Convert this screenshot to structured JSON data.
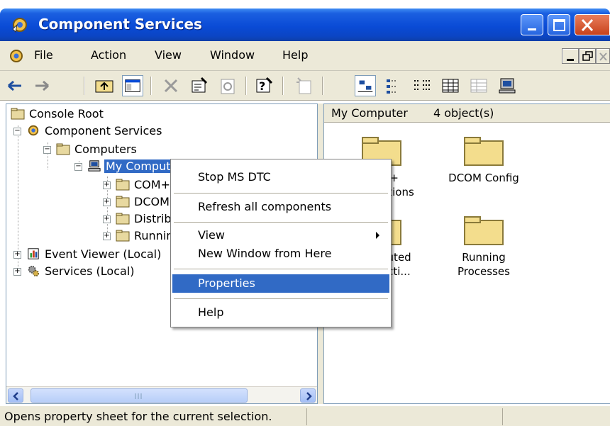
{
  "window": {
    "title": "Component Services"
  },
  "menubar": {
    "items": [
      "File",
      "Action",
      "View",
      "Window",
      "Help"
    ]
  },
  "tree": {
    "root": "Console Root",
    "component_services": "Component Services",
    "computers": "Computers",
    "my_computer": "My Computer",
    "children": [
      "COM+ Applications",
      "DCOM Config",
      "Distributed Transaction Coordinator",
      "Running Processes"
    ],
    "event_viewer": "Event Viewer (Local)",
    "services": "Services (Local)"
  },
  "right_pane": {
    "header_title": "My Computer",
    "header_count": "4 object(s)",
    "items": [
      {
        "line1": "COM+",
        "line2": "Applications"
      },
      {
        "line1": "DCOM Config",
        "line2": ""
      },
      {
        "line1": "Distributed",
        "line2": "Transacti..."
      },
      {
        "line1": "Running",
        "line2": "Processes"
      }
    ]
  },
  "context_menu": {
    "items": [
      "Stop MS DTC",
      "Refresh all components",
      "View",
      "New Window from Here",
      "Properties",
      "Help"
    ],
    "highlighted": "Properties"
  },
  "statusbar": {
    "text": "Opens property sheet for the current selection."
  },
  "colors": {
    "titlebar": "#0a4bd6",
    "selection": "#316ac5",
    "chrome": "#ece9d8"
  }
}
